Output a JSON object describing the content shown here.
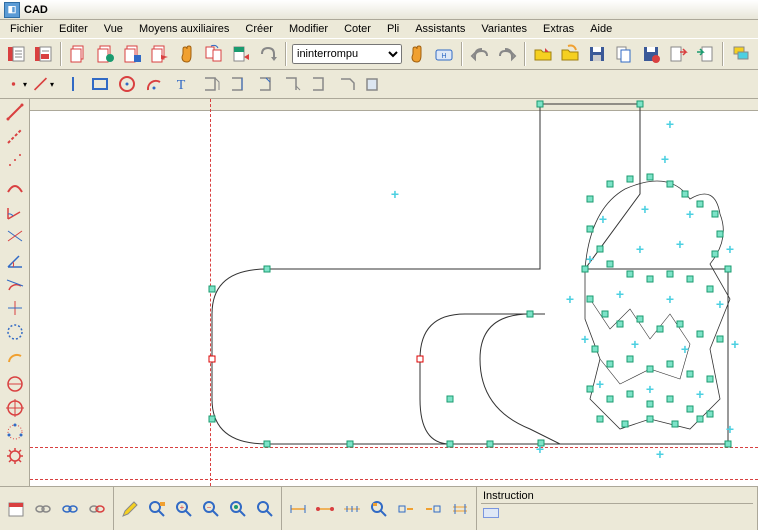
{
  "window": {
    "title": "CAD"
  },
  "menu": {
    "items": [
      "Fichier",
      "Editer",
      "Vue",
      "Moyens auxiliaires",
      "Créer",
      "Modifier",
      "Coter",
      "Pli",
      "Assistants",
      "Variantes",
      "Extras",
      "Aide"
    ]
  },
  "toolbar1": {
    "linetype_selected": "ininterrompu",
    "linetype_options": [
      "ininterrompu"
    ]
  },
  "bottom": {
    "instruction_label": "Instruction"
  },
  "icons": {
    "colors": {
      "red": "#d94040",
      "green": "#1a9b6f",
      "handle": "#7de3c8",
      "cyan": "#4dd0e1",
      "orange": "#f0a030",
      "blue": "#316ac5",
      "yellow": "#f5d020",
      "disk_blue": "#3b5998"
    }
  }
}
